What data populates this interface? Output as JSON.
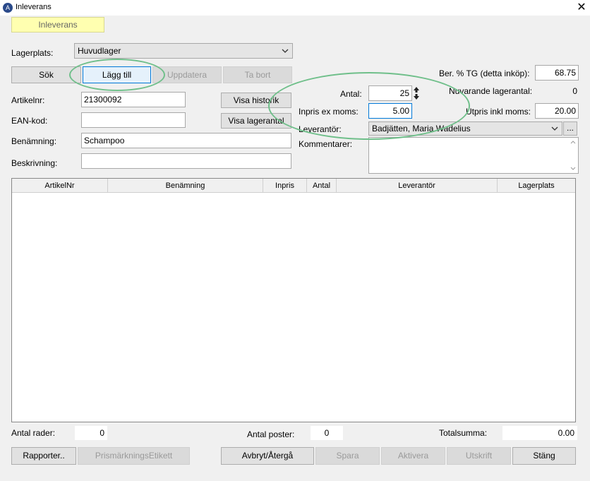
{
  "window": {
    "title": "Inleverans",
    "close_symbol": "✕"
  },
  "tab": {
    "label": "Inleverans"
  },
  "lagerplats": {
    "label": "Lagerplats:",
    "value": "Huvudlager"
  },
  "mode_buttons": {
    "sok": "Sök",
    "lagg_till": "Lägg till",
    "uppdatera": "Uppdatera",
    "ta_bort": "Ta bort"
  },
  "fields": {
    "artikelnr_label": "Artikelnr:",
    "artikelnr_value": "21300092",
    "ean_label": "EAN-kod:",
    "ean_value": "",
    "benamning_label": "Benämning:",
    "benamning_value": "Schampoo",
    "beskrivning_label": "Beskrivning:",
    "beskrivning_value": ""
  },
  "side_buttons": {
    "visa_historik": "Visa historik",
    "visa_lagerantal": "Visa lagerantal"
  },
  "purchase": {
    "antal_label": "Antal:",
    "antal_value": "25",
    "inpris_label": "Inpris ex moms:",
    "inpris_value": "5.00",
    "leverantor_label": "Leverantör:",
    "leverantor_value": "Badjätten, Maria Wadelius",
    "leverantor_more": "...",
    "kommentarer_label": "Kommentarer:",
    "kommentarer_value": ""
  },
  "pricing": {
    "tg_label": "Ber. % TG (detta inköp):",
    "tg_value": "68.75",
    "lagerantal_label": "Nuvarande lagerantal:",
    "lagerantal_value": "0",
    "utpris_label": "Utpris inkl moms:",
    "utpris_value": "20.00"
  },
  "table": {
    "columns": [
      "ArtikelNr",
      "Benämning",
      "Inpris",
      "Antal",
      "Leverantör",
      "Lagerplats"
    ],
    "rows": []
  },
  "summary": {
    "antal_rader_label": "Antal rader:",
    "antal_rader_value": "0",
    "antal_poster_label": "Antal poster:",
    "antal_poster_value": "0",
    "totalsumma_label": "Totalsumma:",
    "totalsumma_value": "0.00"
  },
  "bottom_buttons": {
    "rapporter": "Rapporter..",
    "prismarkning": "PrismärkningsEtikett",
    "avbryt": "Avbryt/Återgå",
    "spara": "Spara",
    "aktivera": "Aktivera",
    "utskrift": "Utskrift",
    "stang": "Stäng"
  },
  "colors": {
    "tab_bg": "#ffffb0",
    "highlight_ellipse": "#6fbf8a",
    "focus_border": "#0078d7"
  }
}
